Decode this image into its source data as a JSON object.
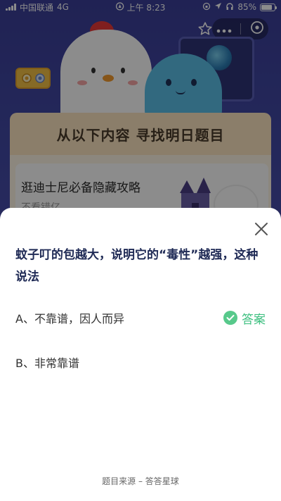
{
  "status_bar": {
    "carrier": "中国联通",
    "network": "4G",
    "time": "上午 8:23",
    "battery": "85%",
    "battery_level": 0.85
  },
  "background": {
    "title": "从以下内容 寻找明日题目",
    "article": {
      "title": "逛迪士尼必备隐藏攻略",
      "subtitle": "不看错亿"
    }
  },
  "quiz": {
    "question": "蚊子叮的包越大，说明它的“毒性”越强，这种说法",
    "options": [
      {
        "label": "A、不靠谱，因人而异",
        "is_answer": true
      },
      {
        "label": "B、非常靠谱",
        "is_answer": false
      }
    ],
    "answer_label": "答案",
    "footer": "题目来源 – 答答星球"
  },
  "colors": {
    "answer_green": "#3fc081",
    "question_text": "#1f2a55",
    "background_purple": "#434aa6"
  },
  "icons": {
    "menu": "more-dots-icon",
    "close_app": "close-circle-icon",
    "favorite": "star-outline-icon",
    "close_sheet": "close-x-icon",
    "answer": "check-circle-icon"
  }
}
